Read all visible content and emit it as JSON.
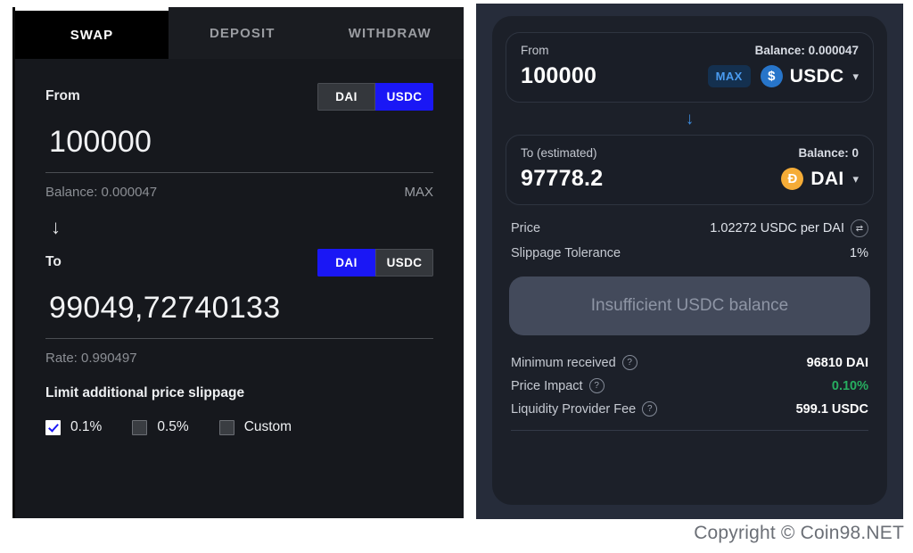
{
  "left_panel": {
    "tabs": [
      {
        "label": "SWAP",
        "active": true
      },
      {
        "label": "DEPOSIT",
        "active": false
      },
      {
        "label": "WITHDRAW",
        "active": false
      }
    ],
    "from": {
      "label": "From",
      "toggle": [
        {
          "label": "DAI",
          "selected": false
        },
        {
          "label": "USDC",
          "selected": true
        }
      ],
      "amount": "100000",
      "balance": "Balance: 0.000047",
      "max": "MAX"
    },
    "swap_arrow": "↓",
    "to": {
      "label": "To",
      "toggle": [
        {
          "label": "DAI",
          "selected": true
        },
        {
          "label": "USDC",
          "selected": false
        }
      ],
      "amount": "99049,72740133",
      "rate": "Rate: 0.990497"
    },
    "slippage": {
      "title": "Limit additional price slippage",
      "options": [
        {
          "label": "0.1%",
          "checked": true
        },
        {
          "label": "0.5%",
          "checked": false
        },
        {
          "label": "Custom",
          "checked": false
        }
      ]
    }
  },
  "right_panel": {
    "from": {
      "label": "From",
      "balance": "Balance: 0.000047",
      "amount": "100000",
      "max": "MAX",
      "token": "USDC",
      "token_symbol": "$",
      "chevron": "⌄"
    },
    "mid_arrow": "↓",
    "to": {
      "label": "To (estimated)",
      "balance": "Balance: 0",
      "amount": "97778.2",
      "token": "DAI",
      "token_symbol": "Ð",
      "chevron": "⌄"
    },
    "info": [
      {
        "label": "Price",
        "value": "1.02272 USDC per DAI",
        "icon": "⇄"
      },
      {
        "label": "Slippage Tolerance",
        "value": "1%",
        "icon": ""
      }
    ],
    "cta": "Insufficient USDC balance",
    "details": [
      {
        "label": "Minimum received",
        "value": "96810 DAI",
        "green": false
      },
      {
        "label": "Price Impact",
        "value": "0.10%",
        "green": true
      },
      {
        "label": "Liquidity Provider Fee",
        "value": "599.1 USDC",
        "green": false
      }
    ],
    "help_icon": "?"
  },
  "copyright": "Copyright © Coin98.NET",
  "colors": {
    "accent_blue": "#1a17f5",
    "link_blue": "#3d8bdd",
    "usdc_blue": "#2775ca",
    "dai_orange": "#f5ac37",
    "green": "#27ae60"
  }
}
